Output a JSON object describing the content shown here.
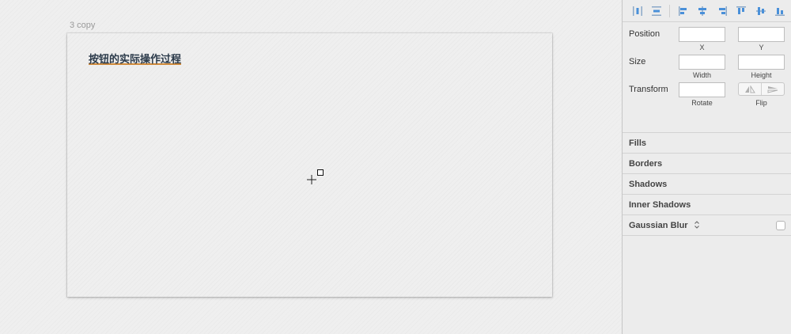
{
  "artboard": {
    "label": "3 copy",
    "title": "按钮的实际操作过程"
  },
  "inspector": {
    "align_icons": [
      "align-left-edge-icon",
      "align-horizontal-center-icon",
      "align-right-edge-icon",
      "align-top-icon",
      "align-vertical-center-icon",
      "align-bottom-icon"
    ],
    "distribute_icons": [
      "distribute-horizontally-icon",
      "distribute-vertically-icon"
    ],
    "position": {
      "label": "Position",
      "x_label": "X",
      "y_label": "Y",
      "x_value": "",
      "y_value": ""
    },
    "size": {
      "label": "Size",
      "width_label": "Width",
      "height_label": "Height",
      "width_value": "",
      "height_value": ""
    },
    "transform": {
      "label": "Transform",
      "rotate_label": "Rotate",
      "flip_label": "Flip",
      "rotate_value": ""
    },
    "sections": {
      "fills": "Fills",
      "borders": "Borders",
      "shadows": "Shadows",
      "inner_shadows": "Inner Shadows",
      "gaussian_blur": "Gaussian Blur"
    },
    "gaussian_blur_enabled": false,
    "accent_color": "#4a90d9"
  }
}
